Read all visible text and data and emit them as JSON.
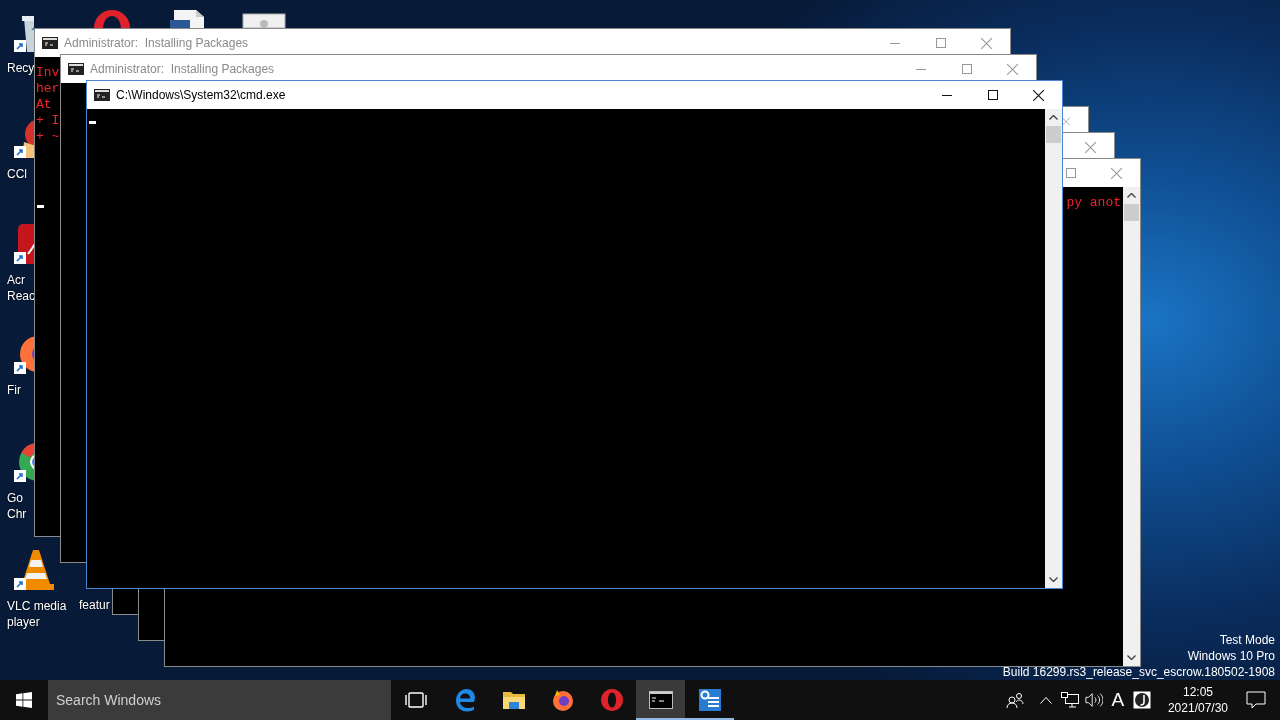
{
  "top_icons": [
    {
      "kind": "ring"
    },
    {
      "kind": "document"
    },
    {
      "kind": "window"
    }
  ],
  "desktop_icons": [
    {
      "kind": "bin",
      "label": "Recy"
    },
    {
      "kind": "cleaner",
      "label": "CCl"
    },
    {
      "kind": "pdf",
      "label": "Acr\nReac"
    },
    {
      "kind": "fox",
      "label": "Fir"
    },
    {
      "kind": "chrome",
      "label": "Go\nChr"
    },
    {
      "kind": "cone",
      "label": "VLC media\nplayer"
    }
  ],
  "second_column_labels": [
    "featur"
  ],
  "windows": [
    {
      "title": "Administrator:  Installing Packages",
      "active": false,
      "controls": [
        {
          "kind": "minimize"
        },
        {
          "kind": "maximize"
        },
        {
          "kind": "close"
        }
      ],
      "lines": [
        "Inv",
        "her",
        "At",
        "+ I",
        "+ ~"
      ],
      "cursor": true
    },
    {
      "title": "Administrator:  Installing Packages",
      "active": false,
      "controls": [
        {
          "kind": "minimize"
        },
        {
          "kind": "maximize"
        },
        {
          "kind": "close"
        }
      ],
      "cursor": false
    },
    {
      "title": "C:\\Windows\\System32\\cmd.exe",
      "active": true,
      "controls": [
        {
          "kind": "minimize"
        },
        {
          "kind": "maximize"
        },
        {
          "kind": "close"
        }
      ],
      "cursor": true
    },
    {
      "active": false,
      "controls": [
        {
          "kind": "close"
        }
      ]
    },
    {
      "active": false,
      "controls": [
        {
          "kind": "close"
        }
      ]
    },
    {
      "active": false,
      "controls": [
        {
          "kind": "maximize"
        },
        {
          "kind": "close"
        }
      ],
      "lines": [
        "py anot"
      ]
    }
  ],
  "system_info": [
    "Test Mode",
    "Windows 10 Pro",
    "Build 16299.rs3_release_svc_escrow.180502-1908"
  ],
  "taskbar": {
    "search": {
      "placeholder": "Search Windows"
    },
    "apps": [
      {
        "kind": "task-view",
        "selected": false,
        "running": false
      },
      {
        "kind": "edge",
        "selected": false,
        "running": false
      },
      {
        "kind": "folder",
        "selected": false,
        "running": false
      },
      {
        "kind": "fox",
        "selected": false,
        "running": false
      },
      {
        "kind": "ring",
        "selected": false,
        "running": false
      },
      {
        "kind": "console",
        "selected": true,
        "running": true
      },
      {
        "kind": "settings",
        "selected": false,
        "running": true
      }
    ],
    "ime": "A",
    "time": "12:05",
    "date": "2021/07/30"
  }
}
